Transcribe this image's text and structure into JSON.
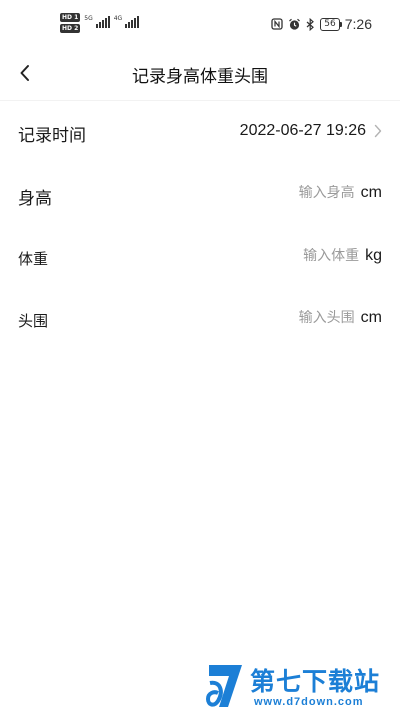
{
  "status_bar": {
    "sim1_badge": "HD 1",
    "sim2_badge": "HD 2",
    "sim1_network": "5G",
    "sim2_network": "4G",
    "battery_level": "56",
    "time": "7:26",
    "icons": [
      "nfc-icon",
      "alarm-icon",
      "bluetooth-icon",
      "battery-icon"
    ]
  },
  "header": {
    "title": "记录身高体重头围",
    "back_icon": "chevron-left-icon"
  },
  "form": {
    "record_time": {
      "label": "记录时间",
      "value": "2022-06-27 19:26"
    },
    "height": {
      "label": "身高",
      "placeholder": "输入身高",
      "value": "",
      "unit": "cm"
    },
    "weight": {
      "label": "体重",
      "placeholder": "输入体重",
      "value": "",
      "unit": "kg"
    },
    "head": {
      "label": "头围",
      "placeholder": "输入头围",
      "value": "",
      "unit": "cm"
    }
  },
  "watermark": {
    "brand": "第七下载站",
    "url": "www.d7down.com"
  },
  "colors": {
    "background": "#ffffff",
    "text": "#1a1a1a",
    "placeholder": "#9a9a9a",
    "watermark": "#1c7fd6"
  }
}
